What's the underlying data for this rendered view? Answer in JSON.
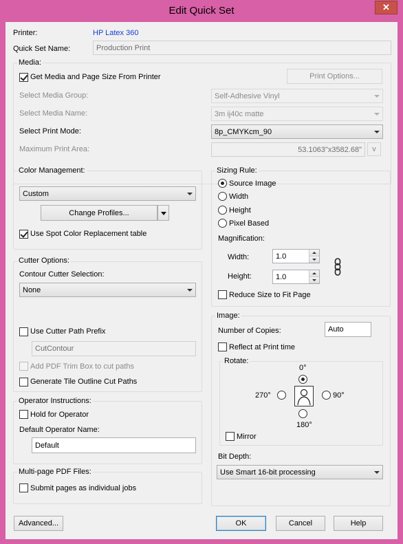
{
  "window": {
    "title": "Edit Quick Set",
    "close_glyph": "✕"
  },
  "printer": {
    "label": "Printer:",
    "value": "HP Latex 360"
  },
  "quickset": {
    "label": "Quick Set Name:",
    "placeholder": "Production Print"
  },
  "media": {
    "title": "Media:",
    "get_from_printer": "Get Media and Page Size From Printer",
    "print_options": "Print Options...",
    "group_label": "Select Media Group:",
    "group_value": "Self-Adhesive Vinyl",
    "name_label": "Select Media Name:",
    "name_value": "3m ij40c matte",
    "mode_label": "Select Print Mode:",
    "mode_value": "8p_CMYKcm_90",
    "area_label": "Maximum Print Area:",
    "area_value": "53.1063\"x3582.68\"",
    "area_unit": "v"
  },
  "color": {
    "title": "Color Management:",
    "profile_value": "Custom",
    "change_profiles": "Change Profiles...",
    "spot_color": "Use Spot Color Replacement table"
  },
  "cutter": {
    "title": "Cutter Options:",
    "contour_label": "Contour Cutter Selection:",
    "contour_value": "None",
    "use_prefix": "Use Cutter Path Prefix",
    "prefix_value": "CutContour",
    "add_trim": "Add PDF Trim Box to cut paths",
    "tile_outline": "Generate Tile Outline Cut Paths"
  },
  "operator": {
    "title": "Operator Instructions:",
    "hold": "Hold for Operator",
    "default_name_label": "Default Operator Name:",
    "default_name_value": "Default"
  },
  "multipage": {
    "title": "Multi-page PDF Files:",
    "submit": "Submit pages as individual jobs"
  },
  "sizing": {
    "title": "Sizing Rule:",
    "source_image": "Source Image",
    "width": "Width",
    "height": "Height",
    "pixel_based": "Pixel Based",
    "magnification": "Magnification:",
    "mag_width_label": "Width:",
    "mag_width_value": "1.0",
    "mag_height_label": "Height:",
    "mag_height_value": "1.0",
    "reduce": "Reduce Size to Fit Page"
  },
  "image": {
    "title": "Image:",
    "copies_label": "Number of Copies:",
    "copies_value": "Auto",
    "reflect": "Reflect at Print time",
    "rotate_title": "Rotate:",
    "r0": "0°",
    "r90": "90°",
    "r180": "180°",
    "r270": "270°",
    "mirror": "Mirror"
  },
  "bitdepth": {
    "title": "Bit Depth:",
    "value": "Use Smart 16-bit processing"
  },
  "footer": {
    "advanced": "Advanced...",
    "ok": "OK",
    "cancel": "Cancel",
    "help": "Help"
  }
}
